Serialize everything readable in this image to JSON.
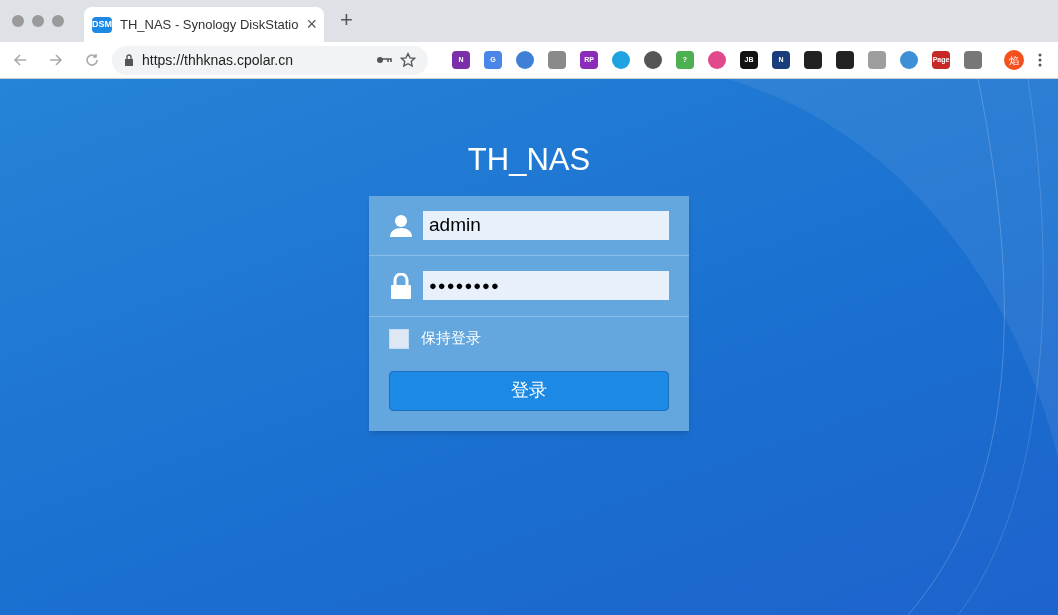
{
  "tab": {
    "favicon": "DSM",
    "title": "TH_NAS - Synology DiskStatio",
    "close": "×"
  },
  "new_tab": "+",
  "address": {
    "url": "https://thhknas.cpolar.cn"
  },
  "extensions": [
    {
      "kind": "square",
      "label": "N",
      "color": "#7b2fa8"
    },
    {
      "kind": "square",
      "label": "G",
      "color": "#4a86e8"
    },
    {
      "kind": "circle",
      "color": "#3f7fd6"
    },
    {
      "kind": "square",
      "color": "#8a8a8a"
    },
    {
      "kind": "square",
      "label": "RP",
      "color": "#8b2bb9"
    },
    {
      "kind": "circle",
      "color": "#1fa3e0"
    },
    {
      "kind": "circle",
      "color": "#555555"
    },
    {
      "kind": "square",
      "label": "?",
      "color": "#4caf50"
    },
    {
      "kind": "circle",
      "color": "#e04a8a"
    },
    {
      "kind": "square",
      "label": "JB",
      "color": "#111111"
    },
    {
      "kind": "square",
      "label": "N",
      "color": "#1a3d7c"
    },
    {
      "kind": "square",
      "color": "#222222"
    },
    {
      "kind": "square",
      "color": "#222222"
    },
    {
      "kind": "square",
      "color": "#9e9e9e"
    },
    {
      "kind": "circle",
      "color": "#3d8fd6"
    },
    {
      "kind": "square",
      "label": "Page",
      "color": "#c62828"
    },
    {
      "kind": "square",
      "color": "#777777"
    }
  ],
  "profile": {
    "label": "焰"
  },
  "login": {
    "title": "TH_NAS",
    "username": "admin",
    "password": "●●●●●●●●",
    "remember": {
      "label": "保持登录",
      "checked": false
    },
    "submit": "登录"
  }
}
